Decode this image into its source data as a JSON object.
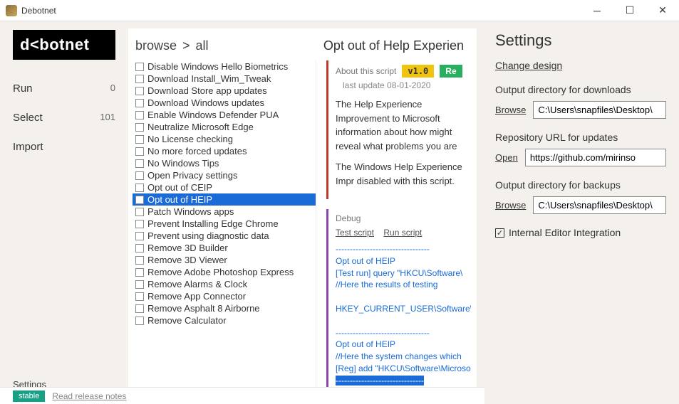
{
  "window": {
    "title": "Debotnet"
  },
  "logo": "d<botnet",
  "sidebar": {
    "items": [
      {
        "label": "Run",
        "count": "0"
      },
      {
        "label": "Select",
        "count": "101"
      },
      {
        "label": "Import",
        "count": ""
      }
    ],
    "settings": "Settings"
  },
  "breadcrumb": {
    "a": "browse",
    "b": "all",
    "right": "Opt out of Help Experien"
  },
  "scripts": [
    "Disable Windows Hello Biometrics",
    "Download Install_Wim_Tweak",
    "Download Store app updates",
    "Download Windows updates",
    "Enable Windows Defender PUA",
    "Neutralize Microsoft Edge",
    "No License checking",
    "No more forced updates",
    "No Windows Tips",
    "Open Privacy settings",
    "Opt out of CEIP",
    "Opt out of HEIP",
    "Patch Windows apps",
    "Prevent Installing Edge Chrome",
    "Prevent using diagnostic data",
    "Remove 3D Builder",
    "Remove 3D Viewer",
    "Remove Adobe Photoshop Express",
    "Remove Alarms & Clock",
    "Remove App Connector",
    "Remove Asphalt 8 Airborne",
    "Remove Calculator"
  ],
  "selected_index": 11,
  "about": {
    "title": "About this script",
    "version": "v1.0",
    "rel": "Re",
    "date": "last update 08-01-2020",
    "p1": "The Help Experience Improvement to Microsoft information about how might reveal what problems you are",
    "p2": "The Windows Help Experience Impr disabled with this script."
  },
  "debug": {
    "title": "Debug",
    "link_test": "Test script",
    "link_run": "Run script",
    "output": "---------------------------------\nOpt out of HEIP\n[Test run] query \"HKCU\\Software\\\n//Here the results of testing\n\nHKEY_CURRENT_USER\\Software\\Micro\n\n---------------------------------\nOpt out of HEIP\n//Here the system changes which\n[Reg] add \"HKCU\\Software\\Microso",
    "selected_line": "-------------------------------"
  },
  "settings": {
    "title": "Settings",
    "change_design": "Change design",
    "groups": [
      {
        "label": "Output directory for downloads",
        "action": "Browse",
        "value": "C:\\Users\\snapfiles\\Desktop\\"
      },
      {
        "label": "Repository URL for updates",
        "action": "Open",
        "value": "https://github.com/mirinso"
      },
      {
        "label": "Output directory for backups",
        "action": "Browse",
        "value": "C:\\Users\\snapfiles\\Desktop\\"
      }
    ],
    "checkbox": {
      "label": "Internal Editor Integration",
      "checked": true
    }
  },
  "status": {
    "badge": "stable",
    "link": "Read release notes"
  }
}
